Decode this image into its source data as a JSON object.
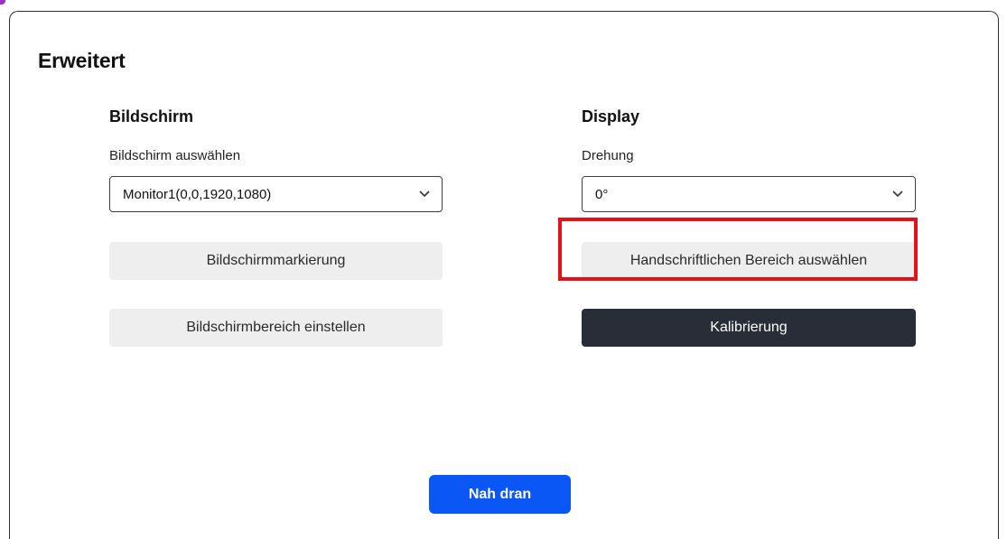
{
  "dialog": {
    "title": "Erweitert",
    "primary_button": "Nah dran"
  },
  "bildschirm": {
    "title": "Bildschirm",
    "select_label": "Bildschirm auswählen",
    "select_value": "Monitor1(0,0,1920,1080)",
    "markierung_button": "Bildschirmmarkierung",
    "bereich_button": "Bildschirmbereich einstellen"
  },
  "display": {
    "title": "Display",
    "rotation_label": "Drehung",
    "rotation_value": "0°",
    "handwriting_button": "Handschriftlichen Bereich auswählen",
    "calibration_button": "Kalibrierung"
  },
  "colors": {
    "highlight": "#e5101a",
    "primary": "#0b57f5",
    "dark_button": "#282d38",
    "light_button": "#eeeeee"
  },
  "icons": [
    "chevron-down-icon"
  ]
}
